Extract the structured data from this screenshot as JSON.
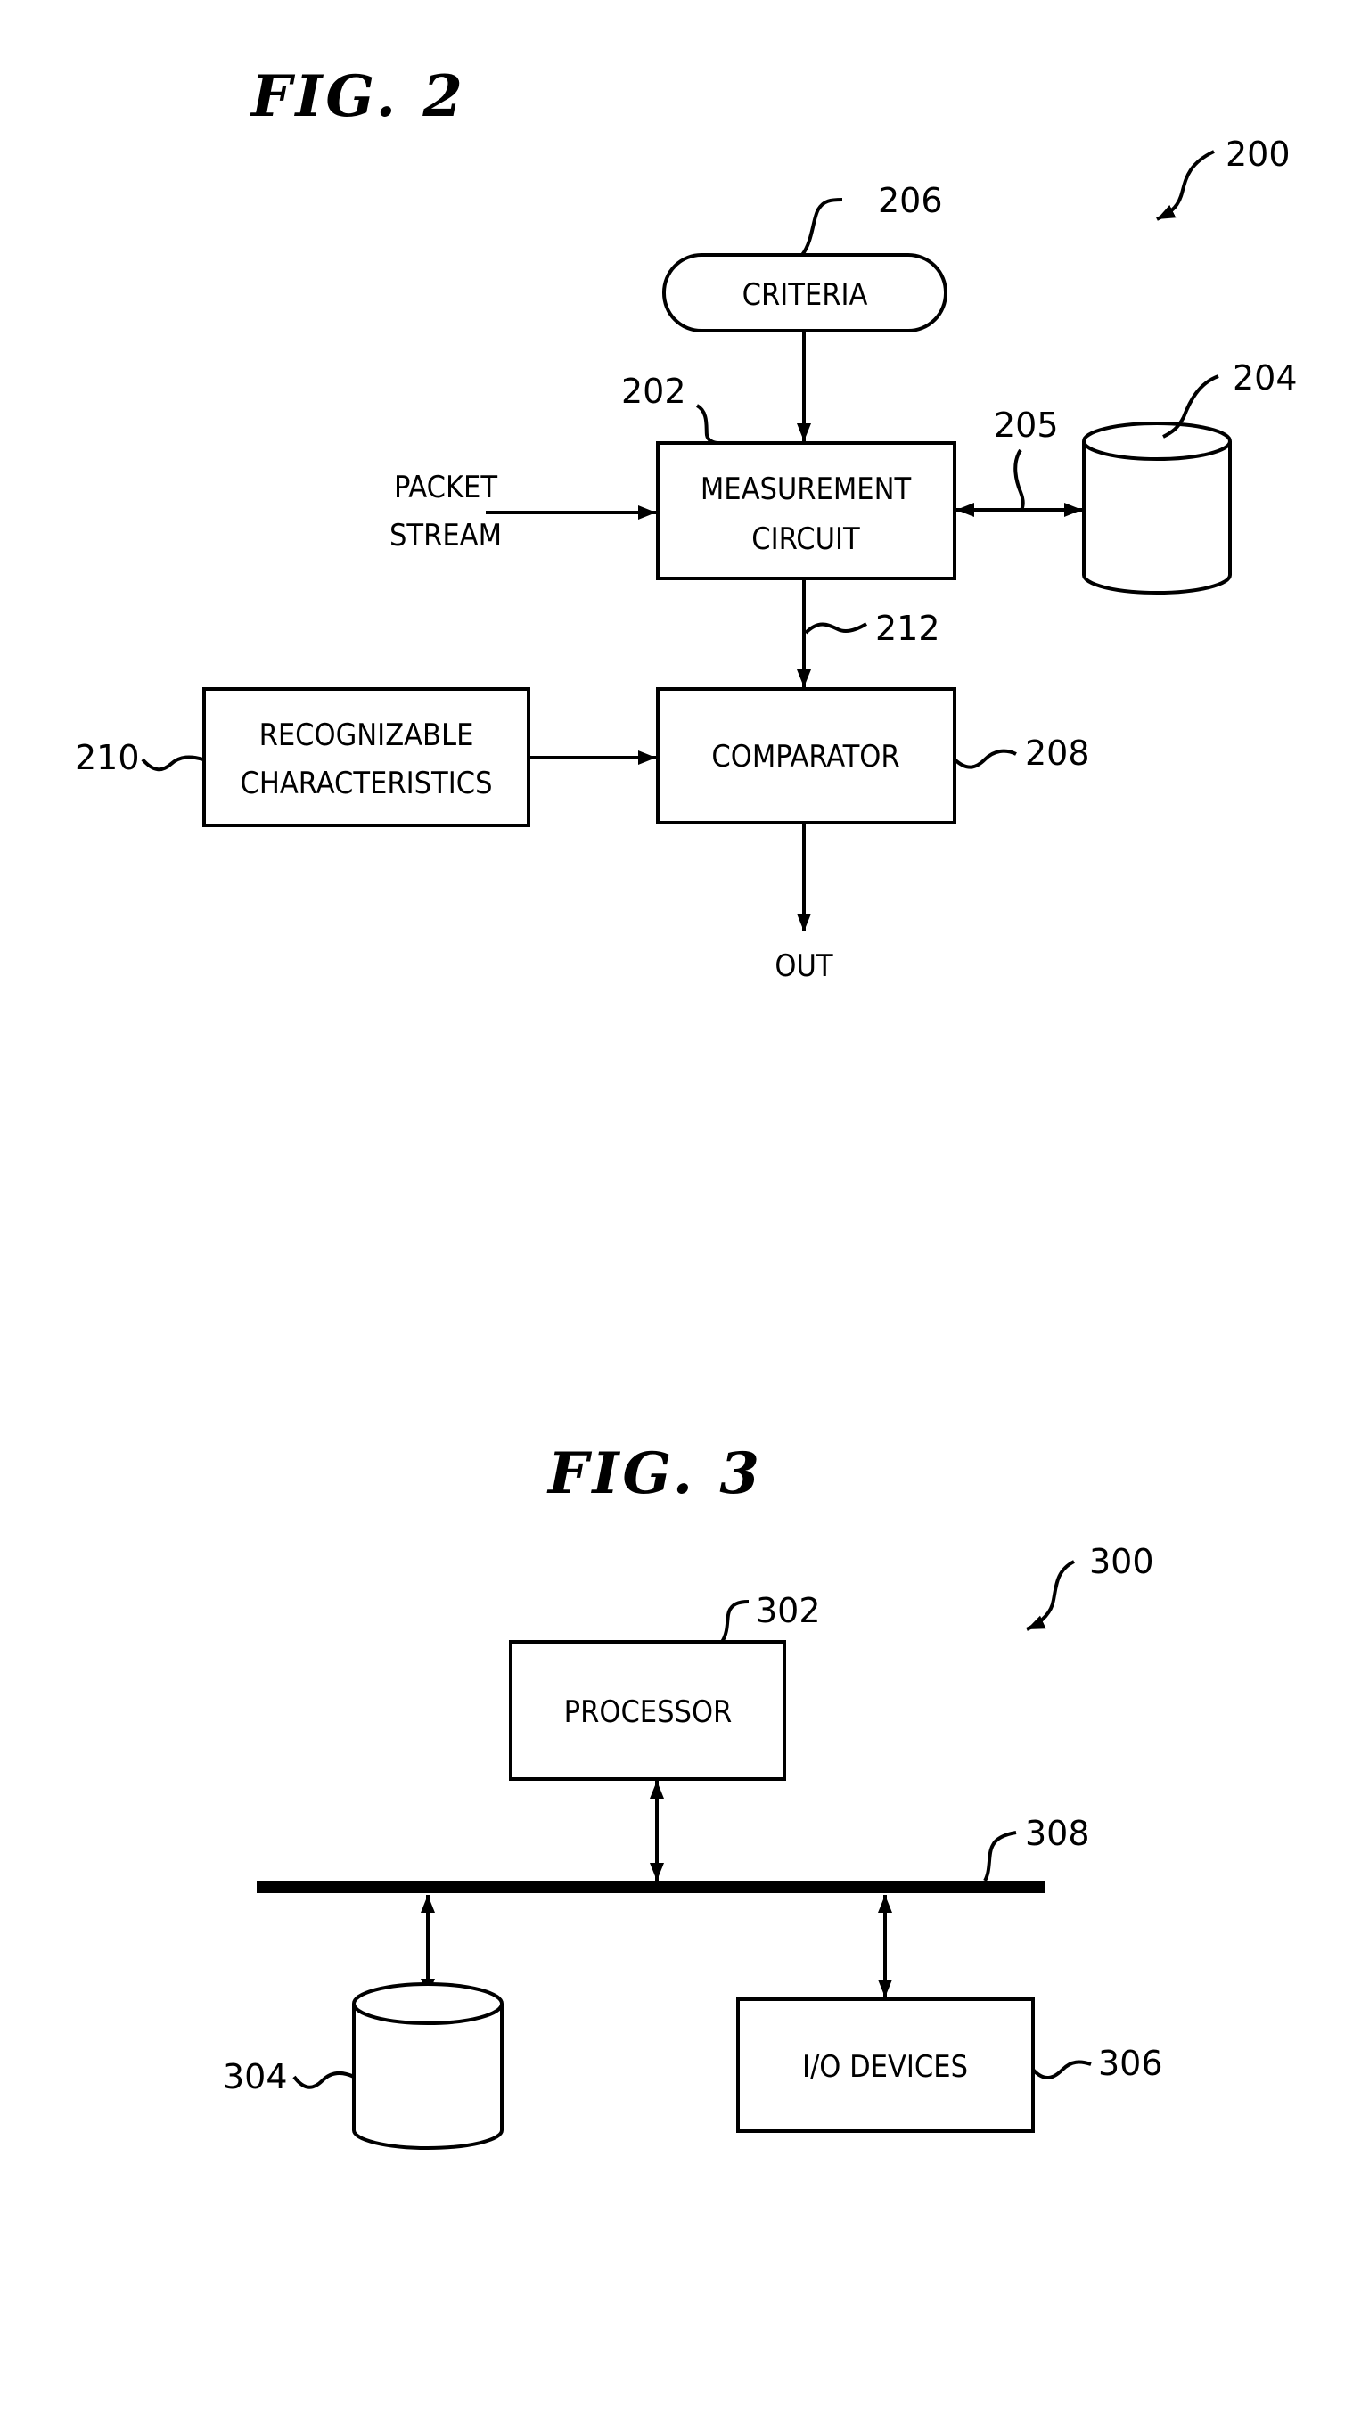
{
  "figures": [
    {
      "title": "FIG. 2",
      "reference": "200",
      "nodes": {
        "criteria": {
          "label": "CRITERIA",
          "ref": "206",
          "shape": "rounded-pill"
        },
        "measurement": {
          "label_line1": "MEASUREMENT",
          "label_line2": "CIRCUIT",
          "ref": "202",
          "shape": "rectangle"
        },
        "storage": {
          "ref": "204",
          "shape": "cylinder"
        },
        "comparator": {
          "label": "COMPARATOR",
          "ref": "208",
          "shape": "rectangle"
        },
        "recognizable": {
          "label_line1": "RECOGNIZABLE",
          "label_line2": "CHARACTERISTICS",
          "ref": "210",
          "shape": "rectangle"
        }
      },
      "inputs": {
        "packet_stream_line1": "PACKET",
        "packet_stream_line2": "STREAM"
      },
      "outputs": {
        "out": "OUT"
      },
      "connections": [
        {
          "from": "criteria",
          "to": "measurement",
          "type": "arrow"
        },
        {
          "from": "packet stream",
          "to": "measurement",
          "type": "arrow"
        },
        {
          "from": "measurement",
          "to": "storage",
          "type": "bidirectional",
          "ref": "205"
        },
        {
          "from": "measurement",
          "to": "comparator",
          "type": "arrow",
          "ref": "212"
        },
        {
          "from": "recognizable",
          "to": "comparator",
          "type": "arrow"
        },
        {
          "from": "comparator",
          "to": "out",
          "type": "arrow"
        }
      ],
      "connection_refs": {
        "link_205": "205",
        "link_212": "212"
      }
    },
    {
      "title": "FIG. 3",
      "reference": "300",
      "nodes": {
        "processor": {
          "label": "PROCESSOR",
          "ref": "302",
          "shape": "rectangle"
        },
        "storage": {
          "ref": "304",
          "shape": "cylinder"
        },
        "io": {
          "label": "I/O DEVICES",
          "ref": "306",
          "shape": "rectangle"
        },
        "bus": {
          "ref": "308",
          "shape": "bus-bar"
        }
      },
      "connections": [
        {
          "from": "processor",
          "to": "bus",
          "type": "bidirectional"
        },
        {
          "from": "bus",
          "to": "storage",
          "type": "bidirectional"
        },
        {
          "from": "bus",
          "to": "io",
          "type": "bidirectional"
        }
      ]
    }
  ]
}
